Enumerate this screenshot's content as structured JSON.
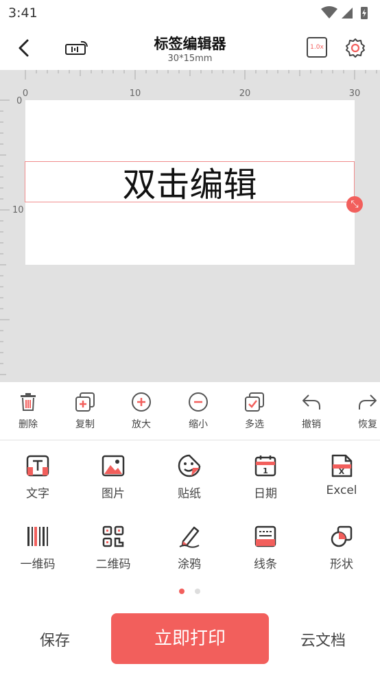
{
  "status_bar": {
    "time": "3:41"
  },
  "header": {
    "title": "标签编辑器",
    "subtitle": "30*15mm",
    "zoom_badge": "1.0x"
  },
  "ruler": {
    "h_labels": [
      "0",
      "10",
      "20",
      "30"
    ],
    "v_labels": [
      "0",
      "10"
    ]
  },
  "canvas": {
    "text": "双击编辑"
  },
  "toolbar": {
    "items": [
      {
        "label": "删除"
      },
      {
        "label": "复制"
      },
      {
        "label": "放大"
      },
      {
        "label": "缩小"
      },
      {
        "label": "多选"
      },
      {
        "label": "撤销"
      },
      {
        "label": "恢复"
      }
    ]
  },
  "elements": {
    "items": [
      {
        "label": "文字"
      },
      {
        "label": "图片"
      },
      {
        "label": "贴纸"
      },
      {
        "label": "日期"
      },
      {
        "label": "Excel"
      },
      {
        "label": "一维码"
      },
      {
        "label": "二维码"
      },
      {
        "label": "涂鸦"
      },
      {
        "label": "线条"
      },
      {
        "label": "形状"
      }
    ]
  },
  "pager": {
    "active_page": 1,
    "page_count": 2
  },
  "bottom": {
    "save": "保存",
    "print": "立即打印",
    "cloud": "云文档"
  },
  "colors": {
    "accent": "#f25f5c",
    "workspace_bg": "#e1e1e1"
  }
}
